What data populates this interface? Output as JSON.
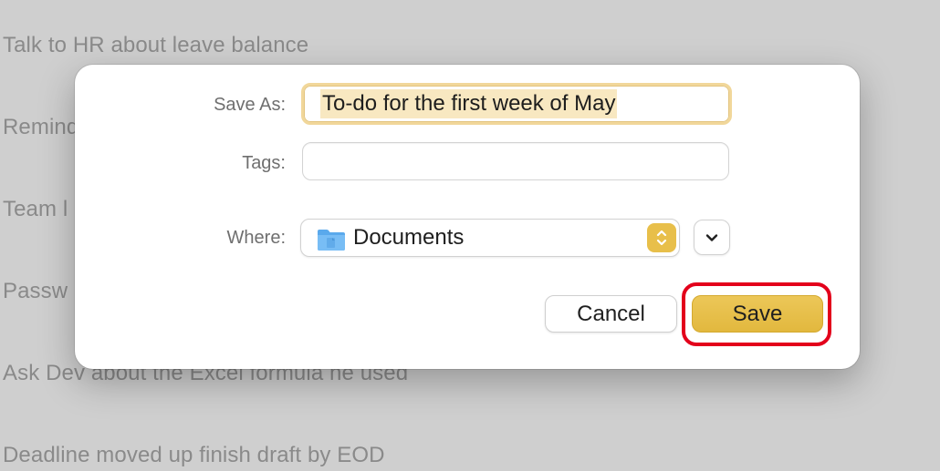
{
  "background_notes": [
    "Talk to HR about leave balance",
    "Remind",
    "Team l",
    "Passw",
    "Ask Dev about the Excel formula he used",
    "Deadline moved up finish draft by EOD"
  ],
  "save_dialog": {
    "save_as_label": "Save As:",
    "save_as_value": "To-do for the first week of May",
    "tags_label": "Tags:",
    "tags_value": "",
    "where_label": "Where:",
    "where_value": "Documents",
    "where_icon": "folder-icon",
    "cancel_label": "Cancel",
    "save_label": "Save"
  },
  "colors": {
    "accent": "#e8bf4a",
    "highlight_ring": "#e3001b",
    "focus_ring": "#f1d79a",
    "selection": "#f8e8c1"
  }
}
